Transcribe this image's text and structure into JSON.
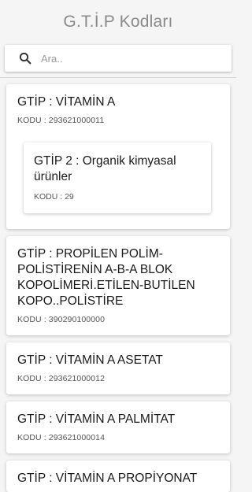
{
  "header": {
    "title": "G.T.İ.P Kodları"
  },
  "search": {
    "placeholder": "Ara..",
    "icon": "search-icon"
  },
  "items": [
    {
      "title": "GTİP : VİTAMİN A",
      "code": "KODU : 293621000011",
      "sub": {
        "title": "GTİP 2 : Organik kimyasal ürünler",
        "code": "KODU : 29"
      }
    },
    {
      "title": "GTİP : PROPİLEN POLİM-POLİSTİRENİN A-B-A BLOK KOPOLİMERİ.ETİLEN-BUTİLEN KOPO..POLİSTİRE",
      "code": "KODU : 390290100000"
    },
    {
      "title": "GTİP : VİTAMİN A ASETAT",
      "code": "KODU : 293621000012"
    },
    {
      "title": "GTİP : VİTAMİN A PALMİTAT",
      "code": "KODU : 293621000014"
    },
    {
      "title": "GTİP : VİTAMİN A PROPİYONAT",
      "code": ""
    }
  ]
}
